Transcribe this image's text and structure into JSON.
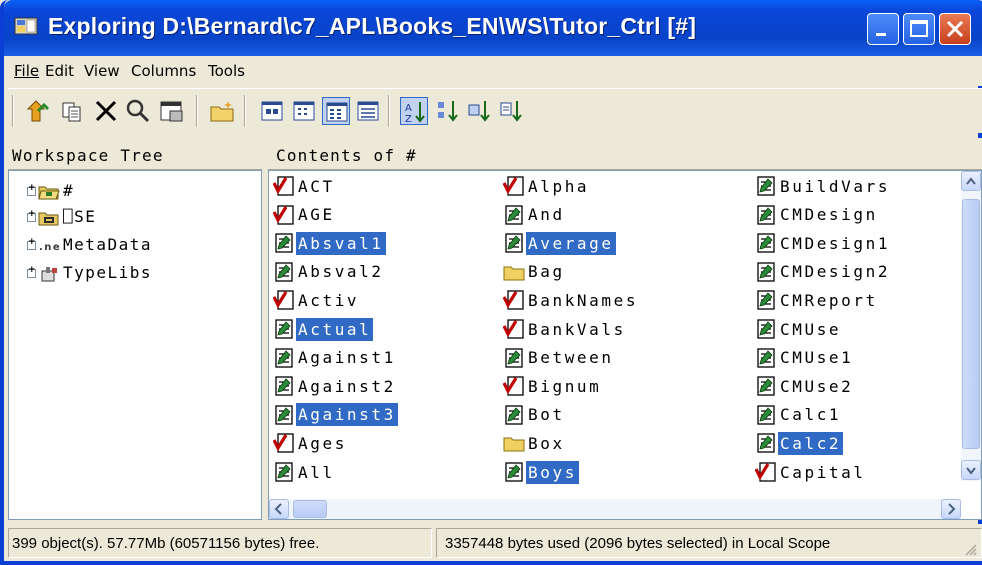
{
  "window": {
    "title": "Exploring D:\\Bernard\\c7_APL\\Books_EN\\WS\\Tutor_Ctrl [#]"
  },
  "menu": [
    {
      "label": "File"
    },
    {
      "label": "Edit"
    },
    {
      "label": "View"
    },
    {
      "label": "Columns"
    },
    {
      "label": "Tools"
    }
  ],
  "toolbar": {
    "buttons": [
      "up-folder-icon",
      "copy-icon",
      "delete-icon",
      "find-icon",
      "properties-icon",
      "new-namespace-icon",
      "large-icons-view-icon",
      "small-icons-view-icon",
      "list-view-icon",
      "details-view-icon",
      "sort-by-name-icon",
      "sort-by-type-icon",
      "sort-by-size-icon",
      "sort-by-date-icon"
    ],
    "pressed": [
      "list-view-icon",
      "sort-by-name-icon"
    ]
  },
  "left_pane": {
    "header": "Workspace Tree",
    "nodes": [
      {
        "label": "#",
        "icon": "open-folder-icon"
      },
      {
        "label": "⎕SE",
        "icon": "session-folder-icon"
      },
      {
        "label": "MetaData",
        "icon": "net-metadata-icon"
      },
      {
        "label": "TypeLibs",
        "icon": "typelib-icon"
      }
    ]
  },
  "right_pane": {
    "header": "Contents of #",
    "columns": [
      [
        {
          "name": "ACT",
          "type": "variable",
          "selected": false
        },
        {
          "name": "AGE",
          "type": "variable",
          "selected": false
        },
        {
          "name": "Absval1",
          "type": "function",
          "selected": true
        },
        {
          "name": "Absval2",
          "type": "function",
          "selected": false
        },
        {
          "name": "Activ",
          "type": "variable",
          "selected": false
        },
        {
          "name": "Actual",
          "type": "function",
          "selected": true
        },
        {
          "name": "Against1",
          "type": "function",
          "selected": false
        },
        {
          "name": "Against2",
          "type": "function",
          "selected": false
        },
        {
          "name": "Against3",
          "type": "function",
          "selected": true
        },
        {
          "name": "Ages",
          "type": "variable",
          "selected": false
        },
        {
          "name": "All",
          "type": "function",
          "selected": false
        }
      ],
      [
        {
          "name": "Alpha",
          "type": "variable",
          "selected": false
        },
        {
          "name": "And",
          "type": "function",
          "selected": false
        },
        {
          "name": "Average",
          "type": "function",
          "selected": true
        },
        {
          "name": "Bag",
          "type": "namespace",
          "selected": false
        },
        {
          "name": "BankNames",
          "type": "variable",
          "selected": false
        },
        {
          "name": "BankVals",
          "type": "variable",
          "selected": false
        },
        {
          "name": "Between",
          "type": "function",
          "selected": false
        },
        {
          "name": "Bignum",
          "type": "variable",
          "selected": false
        },
        {
          "name": "Bot",
          "type": "function",
          "selected": false
        },
        {
          "name": "Box",
          "type": "namespace",
          "selected": false
        },
        {
          "name": "Boys",
          "type": "function",
          "selected": true
        }
      ],
      [
        {
          "name": "BuildVars",
          "type": "function",
          "selected": false
        },
        {
          "name": "CMDesign",
          "type": "function",
          "selected": false
        },
        {
          "name": "CMDesign1",
          "type": "function",
          "selected": false
        },
        {
          "name": "CMDesign2",
          "type": "function",
          "selected": false
        },
        {
          "name": "CMReport",
          "type": "function",
          "selected": false
        },
        {
          "name": "CMUse",
          "type": "function",
          "selected": false
        },
        {
          "name": "CMUse1",
          "type": "function",
          "selected": false
        },
        {
          "name": "CMUse2",
          "type": "function",
          "selected": false
        },
        {
          "name": "Calc1",
          "type": "function",
          "selected": false
        },
        {
          "name": "Calc2",
          "type": "function",
          "selected": true
        },
        {
          "name": "Capital",
          "type": "variable",
          "selected": false
        }
      ]
    ]
  },
  "status": {
    "left": "399 object(s). 57.77Mb (60571156 bytes) free.",
    "right": "3357448 bytes used (2096 bytes selected)  in Local Scope"
  }
}
